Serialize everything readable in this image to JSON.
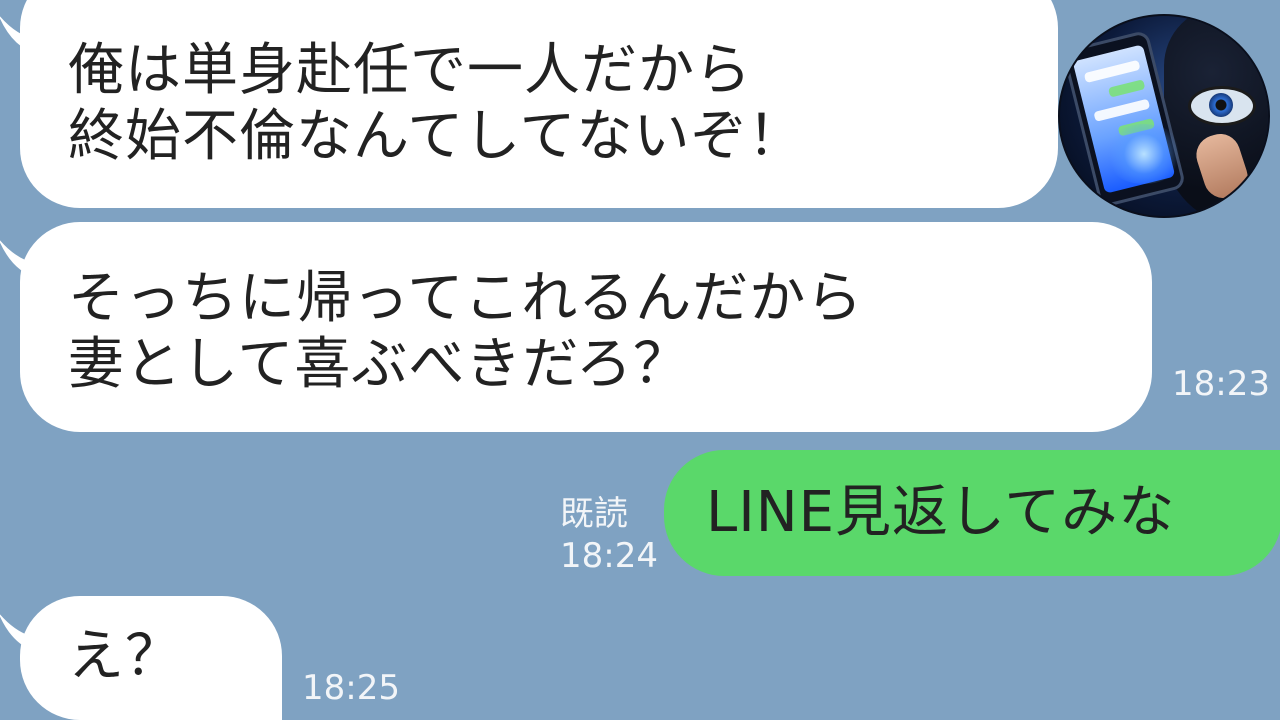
{
  "messages": [
    {
      "id": "m1",
      "direction": "incoming",
      "lines": [
        "俺は単身赴任で一人だから",
        "終始不倫なんてしてないぞ！"
      ]
    },
    {
      "id": "m2",
      "direction": "incoming",
      "lines": [
        "そっちに帰ってこれるんだから",
        "妻として喜ぶべきだろ？"
      ],
      "time": "18:23"
    },
    {
      "id": "m3",
      "direction": "outgoing",
      "lines": [
        "LINE見返してみな"
      ],
      "read_label": "既読",
      "time": "18:24"
    },
    {
      "id": "m4",
      "direction": "incoming",
      "lines": [
        "え？"
      ],
      "time": "18:25"
    }
  ],
  "colors": {
    "background": "#7fa2c2",
    "incoming_bubble": "#ffffff",
    "outgoing_bubble": "#5ad86a",
    "meta_text": "#f2f5f8"
  },
  "avatar": {
    "icon": "hooded-figure-phone-avatar"
  }
}
